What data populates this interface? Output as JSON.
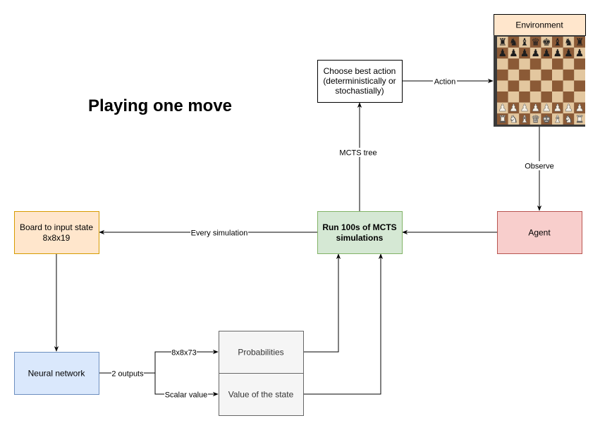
{
  "title": "Playing one move",
  "nodes": {
    "environment": "Environment",
    "choose_action": [
      "Choose best action",
      "(deterministically or",
      "stochastially)"
    ],
    "run_mcts": [
      "Run 100s of MCTS",
      "simulations"
    ],
    "agent": "Agent",
    "board_input": [
      "Board to input state",
      "8x8x19"
    ],
    "neural_network": "Neural network",
    "probabilities": "Probabilities",
    "value": "Value of the state"
  },
  "edges": {
    "action": "Action",
    "mcts_tree": "MCTS tree",
    "observe": "Observe",
    "every_simulation": "Every simulation",
    "two_outputs": "2 outputs",
    "policy_shape": "8x8x73",
    "scalar_value": "Scalar value"
  },
  "board": {
    "ranks": [
      "rnbqkbnr",
      "pppppppp",
      "........",
      "........",
      "........",
      "........",
      "PPPPPPPP",
      "RNBQKBNR"
    ],
    "light_color": "#e3c79f",
    "dark_color": "#8b5a36"
  },
  "colors": {
    "peach_fill": "#ffe6cc",
    "peach_stroke": "#d79b00",
    "green_fill": "#d5e8d4",
    "green_stroke": "#82b366",
    "red_fill": "#f8cecc",
    "red_stroke": "#b85450",
    "blue_fill": "#dae8fc",
    "blue_stroke": "#6c8ebf",
    "gray_fill": "#f5f5f5",
    "gray_stroke": "#666666"
  }
}
